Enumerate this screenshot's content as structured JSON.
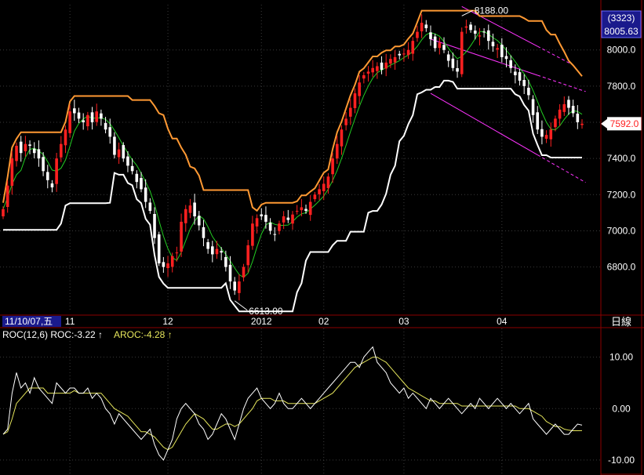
{
  "colors": {
    "background": "#000000",
    "grid": "#3a3a3a",
    "frame": "#8b0000",
    "up_candle": "#ff2020",
    "down_candle": "#ffffff",
    "upper_band": "#ff9933",
    "lower_band": "#ffffff",
    "short_ma": "#22cc22",
    "channel": "#ff33ff",
    "roc_line": "#ffffff",
    "aroc_line": "#e6e65c",
    "axis_text": "#ffffff",
    "highlight_box": "#1a1a8c"
  },
  "header": {
    "date_label": "11/10/07,五",
    "period_label": "日線"
  },
  "price_axis": {
    "highlight_count": "(3323)",
    "highlight_value": "8005.63",
    "last_price": "7592.0"
  },
  "annotations": {
    "high": "8188.00",
    "low": "6613.00"
  },
  "indicator": {
    "roc_label": "ROC(12,6) ROC:-3.22 ↑",
    "aroc_label": "AROC:-4.28 ↑"
  },
  "chart_data": [
    {
      "type": "candlestick",
      "title": "",
      "x_labels": [
        "11",
        "12",
        "2012",
        "02",
        "03",
        "04"
      ],
      "x_label_index": [
        15,
        37,
        58,
        72,
        90,
        112
      ],
      "y_ticks": [
        6800,
        7000,
        7200,
        7400,
        7600,
        7800,
        8000
      ],
      "y_tick_labels": [
        "6800.0",
        "7000.0",
        "7200.0",
        "7400.0",
        "7600.0",
        "7800.0",
        "8000.0"
      ],
      "ylim": [
        6560,
        8250
      ],
      "grid": true,
      "close": [
        7120,
        7250,
        7400,
        7470,
        7430,
        7480,
        7470,
        7430,
        7400,
        7330,
        7280,
        7240,
        7400,
        7480,
        7560,
        7660,
        7650,
        7620,
        7600,
        7640,
        7600,
        7660,
        7620,
        7560,
        7520,
        7420,
        7450,
        7400,
        7360,
        7330,
        7270,
        7230,
        7160,
        7110,
        6960,
        6820,
        6800,
        6820,
        6860,
        6880,
        7050,
        7120,
        7140,
        7080,
        7030,
        6960,
        6900,
        6870,
        6900,
        6880,
        6800,
        6720,
        6670,
        6720,
        6800,
        6920,
        7040,
        7070,
        7080,
        7050,
        7000,
        6980,
        7040,
        7080,
        7060,
        7090,
        7110,
        7130,
        7110,
        7160,
        7200,
        7230,
        7260,
        7300,
        7400,
        7480,
        7560,
        7620,
        7680,
        7760,
        7820,
        7860,
        7880,
        7900,
        7910,
        7890,
        7930,
        7950,
        7960,
        7970,
        7980,
        8000,
        8050,
        8100,
        8150,
        8120,
        8060,
        8010,
        8040,
        8000,
        7940,
        7900,
        7880,
        8100,
        8130,
        8110,
        8090,
        8080,
        8100,
        8050,
        8020,
        8010,
        7960,
        7950,
        7900,
        7860,
        7830,
        7800,
        7750,
        7640,
        7560,
        7520,
        7530,
        7560,
        7620,
        7670,
        7700,
        7680,
        7650,
        7600,
        7592
      ],
      "series": [
        {
          "name": "",
          "role": "upper_band"
        },
        {
          "name": "",
          "role": "lower_band"
        },
        {
          "name": "",
          "role": "short_ma"
        }
      ],
      "annotations": [
        {
          "label": "8188.00",
          "index": 103,
          "value": 8188
        },
        {
          "label": "6613.00",
          "index": 52,
          "value": 6613
        }
      ]
    },
    {
      "type": "line",
      "title": "",
      "y_ticks": [
        10,
        0,
        -10
      ],
      "y_tick_labels": [
        "10.00",
        "0.00",
        "-10.00"
      ],
      "ylim": [
        -12,
        13
      ],
      "grid": true,
      "series": [
        {
          "name": "ROC",
          "values": [
            -5,
            -4,
            3,
            7,
            4,
            5,
            3,
            6,
            4,
            3,
            2,
            1,
            5,
            4,
            3,
            4,
            4,
            3,
            3,
            4,
            2,
            3,
            2,
            0,
            -1,
            -3,
            -1,
            -2,
            -3,
            -4,
            -5,
            -6,
            -5,
            -4,
            -7,
            -9,
            -10,
            -8,
            -6,
            -2,
            0,
            1,
            0,
            -1,
            -3,
            -4,
            -6,
            -5,
            -3,
            -1,
            -2,
            -4,
            -6,
            -3,
            0,
            2,
            3,
            4,
            2,
            1,
            0,
            1,
            3,
            1,
            0,
            0,
            1,
            2,
            1,
            0,
            1,
            2,
            3,
            4,
            5,
            6,
            7,
            8,
            9,
            9,
            8,
            10,
            11,
            12,
            9,
            8,
            7,
            5,
            4,
            3,
            4,
            2,
            3,
            2,
            1,
            0,
            2,
            1,
            0,
            1,
            2,
            1,
            0,
            -1,
            0,
            1,
            0,
            2,
            1,
            0,
            1,
            2,
            1,
            0,
            1,
            0,
            -1,
            0,
            1,
            -2,
            -3,
            -4,
            -5,
            -4,
            -3,
            -4,
            -5,
            -5,
            -4,
            -3,
            -3.22
          ]
        },
        {
          "name": "AROC",
          "values": [
            -5,
            -4.5,
            -2,
            1,
            2,
            3,
            4,
            4,
            4,
            4,
            3,
            3,
            3,
            3,
            3,
            3,
            3.5,
            3,
            3,
            3,
            3,
            3,
            3,
            2,
            1,
            0,
            -0.5,
            -1,
            -1.5,
            -2.5,
            -3.5,
            -4.5,
            -4.5,
            -5,
            -5.5,
            -6.5,
            -7.5,
            -8,
            -7.5,
            -6,
            -4.5,
            -3,
            -2,
            -1,
            -1.5,
            -2,
            -3,
            -4,
            -4,
            -3.5,
            -3,
            -3,
            -3.5,
            -3,
            -2,
            -1,
            0,
            1.5,
            2,
            2,
            2,
            1.5,
            1.5,
            1.5,
            1,
            1,
            1,
            1,
            1,
            1,
            1,
            1.5,
            2,
            2.5,
            3,
            4,
            5,
            6,
            7,
            8,
            8.5,
            9,
            9.5,
            10,
            10,
            9.5,
            9,
            8,
            7,
            6,
            5,
            4,
            3.5,
            3,
            2.5,
            2,
            1.5,
            1.5,
            1,
            1,
            1,
            1,
            1,
            0.5,
            0.5,
            0.5,
            0.5,
            0.5,
            0.5,
            0.5,
            0.5,
            0.5,
            0.5,
            0.5,
            0.5,
            0.5,
            0,
            0,
            0,
            -0.5,
            -1,
            -1.5,
            -2.5,
            -3,
            -3.5,
            -3.5,
            -4,
            -4.2,
            -4.3,
            -4.3,
            -4.28
          ]
        }
      ]
    }
  ]
}
